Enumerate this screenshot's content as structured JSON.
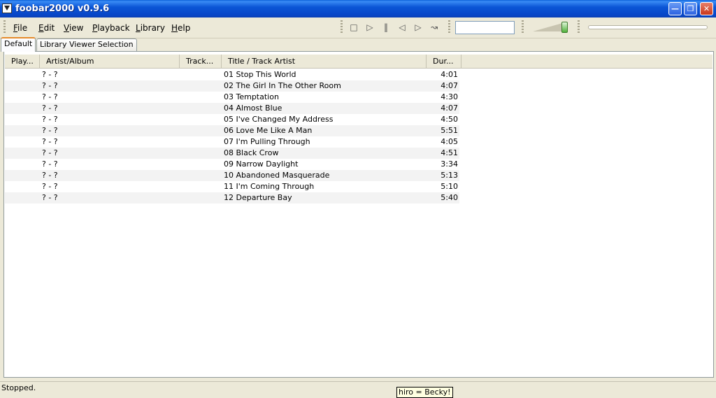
{
  "window": {
    "title": "foobar2000 v0.9.6"
  },
  "menu": [
    {
      "label": "File",
      "key": "F",
      "rest": "ile"
    },
    {
      "label": "Edit",
      "key": "E",
      "rest": "dit"
    },
    {
      "label": "View",
      "key": "V",
      "rest": "iew"
    },
    {
      "label": "Playback",
      "key": "P",
      "rest": "layback"
    },
    {
      "label": "Library",
      "key": "L",
      "rest": "ibrary"
    },
    {
      "label": "Help",
      "key": "H",
      "rest": "elp"
    }
  ],
  "toolbar": {
    "icons": [
      "stop-icon",
      "play-icon",
      "pause-icon",
      "previous-icon",
      "next-icon",
      "random-icon"
    ],
    "search_value": "",
    "volume_level": 0.95
  },
  "tabs": [
    {
      "label": "Default",
      "active": true
    },
    {
      "label": "Library Viewer Selection",
      "active": false
    }
  ],
  "columns": [
    "Play...",
    "Artist/Album",
    "Track...",
    "Title / Track Artist",
    "Dur..."
  ],
  "tracks": [
    {
      "artist": "? - ?",
      "title": "01 Stop This World",
      "duration": "4:01"
    },
    {
      "artist": "? - ?",
      "title": "02 The Girl In The Other Room",
      "duration": "4:07"
    },
    {
      "artist": "? - ?",
      "title": "03 Temptation",
      "duration": "4:30"
    },
    {
      "artist": "? - ?",
      "title": "04 Almost Blue",
      "duration": "4:07"
    },
    {
      "artist": "? - ?",
      "title": "05 I've Changed My Address",
      "duration": "4:50"
    },
    {
      "artist": "? - ?",
      "title": "06 Love Me Like A Man",
      "duration": "5:51"
    },
    {
      "artist": "? - ?",
      "title": "07 I'm Pulling Through",
      "duration": "4:05"
    },
    {
      "artist": "? - ?",
      "title": "08 Black Crow",
      "duration": "4:51"
    },
    {
      "artist": "? - ?",
      "title": "09 Narrow Daylight",
      "duration": "3:34"
    },
    {
      "artist": "? - ?",
      "title": "10 Abandoned Masquerade",
      "duration": "5:13"
    },
    {
      "artist": "? - ?",
      "title": "11 I'm Coming Through",
      "duration": "5:10"
    },
    {
      "artist": "? - ?",
      "title": "12 Departure Bay",
      "duration": "5:40"
    }
  ],
  "status": {
    "text": "Stopped.",
    "tooltip": "hiro = Becky!"
  },
  "colors": {
    "titlebar": "#0a56d6",
    "active_tab_accent": "#e68b2c",
    "volume_thumb": "#4fb03a"
  }
}
